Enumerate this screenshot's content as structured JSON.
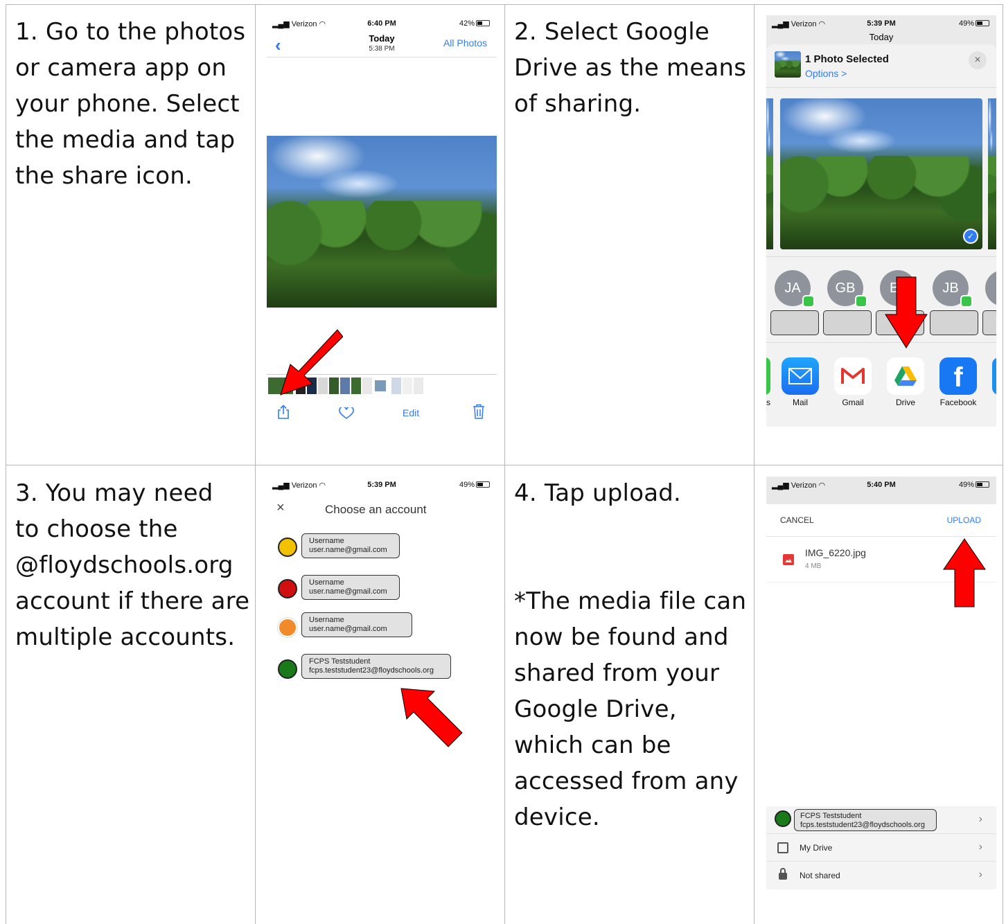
{
  "steps": {
    "step1": {
      "lines": [
        "1. Go to the photos",
        "or camera app on",
        "your phone. Select",
        "the media and tap",
        "the share icon."
      ]
    },
    "step2": {
      "lines": [
        "2. Select Google",
        "Drive as the means",
        "of sharing."
      ]
    },
    "step3": {
      "lines": [
        "3.  You may need",
        "to choose the",
        "@floydschools.org",
        "account if there are",
        "multiple accounts."
      ]
    },
    "step4": {
      "lines": [
        "4. Tap upload."
      ],
      "note_lines": [
        "*The media file can",
        "now be found and",
        "shared from your",
        "Google Drive,",
        "which can be",
        "accessed from any",
        "device."
      ]
    }
  },
  "shot1": {
    "carrier": "Verizon",
    "time": "6:40 PM",
    "battery": "42%",
    "battery_fill": 0.42,
    "title": "Today",
    "subtitle": "5:38 PM",
    "right_link": "All Photos",
    "edit_label": "Edit"
  },
  "shot2": {
    "carrier": "Verizon",
    "time": "5:39 PM",
    "battery": "49%",
    "battery_fill": 0.49,
    "header_under": "Today",
    "selected_title": "1 Photo Selected",
    "options_link": "Options >",
    "contacts": [
      "JA",
      "GB",
      "B",
      "JB"
    ],
    "apps": [
      {
        "label": "s"
      },
      {
        "label": "Mail"
      },
      {
        "label": "Gmail"
      },
      {
        "label": "Drive"
      },
      {
        "label": "Facebook"
      }
    ]
  },
  "shot3": {
    "carrier": "Verizon",
    "time": "5:39 PM",
    "battery": "49%",
    "battery_fill": 0.49,
    "title": "Choose an account",
    "accounts": [
      {
        "name": "Username",
        "email": "user.name@gmail.com",
        "color": "#f2c200"
      },
      {
        "name": "Username",
        "email": "user.name@gmail.com",
        "color": "#d01010"
      },
      {
        "name": "Username",
        "email": "user.name@gmail.com",
        "color": "#f08a2a"
      },
      {
        "name": "FCPS Teststudent",
        "email": "fcps.teststudent23@floydschools.org",
        "color": "#1a7a1a"
      }
    ]
  },
  "shot4": {
    "carrier": "Verizon",
    "time": "5:40 PM",
    "battery": "49%",
    "battery_fill": 0.49,
    "cancel": "CANCEL",
    "upload": "UPLOAD",
    "file_name": "IMG_6220.jpg",
    "file_size": "4 MB",
    "account_name": "FCPS Teststudent",
    "account_email": "fcps.teststudent23@floydschools.org",
    "my_drive": "My Drive",
    "not_shared": "Not shared"
  },
  "colors": {
    "ios_blue": "#2f7cf6",
    "arrow_red": "#ff0000",
    "grid": "#b8b8b8"
  }
}
